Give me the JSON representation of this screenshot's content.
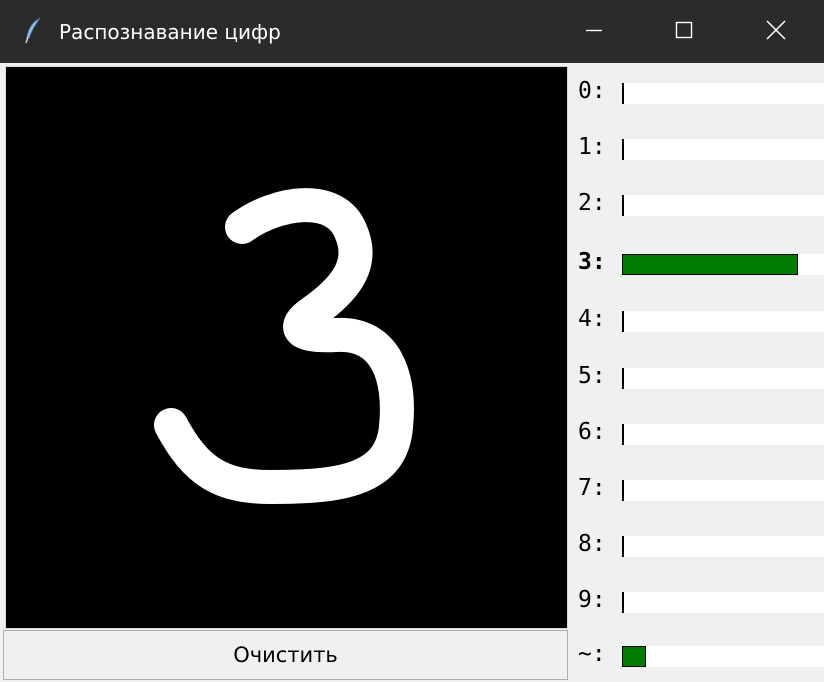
{
  "window": {
    "title": "Распознавание цифр",
    "app_icon": "feather-icon",
    "controls": [
      "minimize-icon",
      "maximize-icon",
      "close-icon"
    ]
  },
  "canvas": {
    "background": "#000000",
    "stroke_color": "#ffffff",
    "drawn_digit": "3"
  },
  "clear_button": {
    "label": "Очистить"
  },
  "bar_color": "#007d00",
  "predictions": [
    {
      "label": "0:",
      "probability": 0.0
    },
    {
      "label": "1:",
      "probability": 0.0
    },
    {
      "label": "2:",
      "probability": 0.0
    },
    {
      "label": "3:",
      "probability": 0.88,
      "top": true
    },
    {
      "label": "4:",
      "probability": 0.0
    },
    {
      "label": "5:",
      "probability": 0.0
    },
    {
      "label": "6:",
      "probability": 0.0
    },
    {
      "label": "7:",
      "probability": 0.0
    },
    {
      "label": "8:",
      "probability": 0.0
    },
    {
      "label": "9:",
      "probability": 0.0
    },
    {
      "label": "~:",
      "probability": 0.12
    }
  ]
}
